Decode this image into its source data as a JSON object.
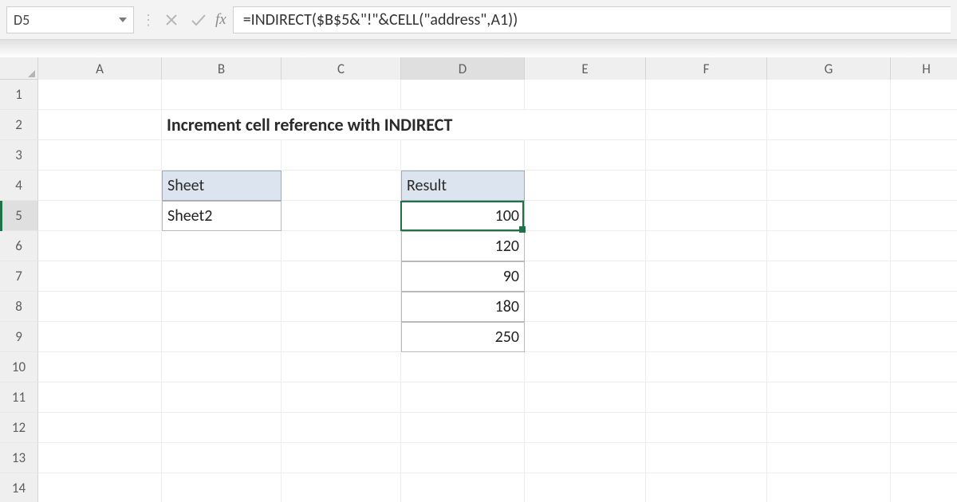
{
  "namebox": {
    "value": "D5"
  },
  "formula_bar": {
    "value": "=INDIRECT($B$5&\"!\"&CELL(\"address\",A1))",
    "fx_label": "fx"
  },
  "columns": [
    "A",
    "B",
    "C",
    "D",
    "E",
    "F",
    "G",
    "H"
  ],
  "rows": [
    "1",
    "2",
    "3",
    "4",
    "5",
    "6",
    "7",
    "8",
    "9",
    "10",
    "11",
    "12",
    "13",
    "14"
  ],
  "active": {
    "col": "D",
    "row": "5"
  },
  "cells": {
    "B2_span_title": "Increment cell reference with INDIRECT",
    "B4": "Sheet",
    "B5": "Sheet2",
    "D4": "Result",
    "D5": "100",
    "D6": "120",
    "D7": "90",
    "D8": "180",
    "D9": "250"
  },
  "colors": {
    "selection": "#1f7246",
    "header_fill": "#dbe4ef"
  }
}
